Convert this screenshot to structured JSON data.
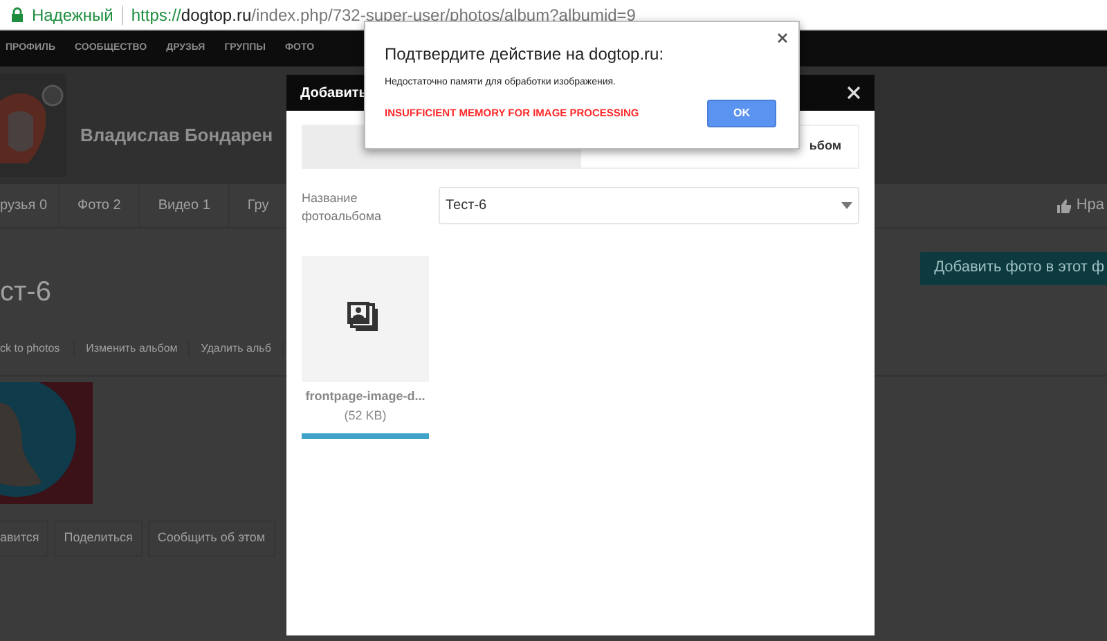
{
  "address_bar": {
    "security": "Надежный",
    "url_scheme": "https://",
    "url_host": "dogtop.ru",
    "url_path": "/index.php/732-super-user/photos/album?albumid=9"
  },
  "nav": [
    "ПРОФИЛЬ",
    "СООБЩЕСТВО",
    "ДРУЗЬЯ",
    "ГРУППЫ",
    "ФОТО"
  ],
  "profile": {
    "name": "Владислав Бондарен"
  },
  "profile_tabs": [
    "рузья 0",
    "Фото 2",
    "Видео 1",
    "Гру"
  ],
  "like_label": "Нра",
  "album": {
    "title": "ст-6",
    "add_button": "Добавить фото в этот ф",
    "links": [
      "ck to photos",
      "Изменить альбом",
      "Удалить альб"
    ],
    "actions": [
      "авится",
      "Поделиться",
      "Сообщить об этом"
    ]
  },
  "modal": {
    "title": "Добавить",
    "tabs": [
      {
        "selected": true
      },
      {
        "label": "ьбом",
        "selected": false
      }
    ],
    "album_label": "Название фотоальбома",
    "album_value": "Тест-6",
    "files": [
      {
        "name": "frontpage-image-d...",
        "size": "(52 KB)",
        "level": 1
      }
    ]
  },
  "alert": {
    "title": "Подтвердите действие на dogtop.ru:",
    "message": "Недостаточно памяти для обработки изображения.",
    "error": "INSUFFICIENT MEMORY FOR IMAGE PROCESSING",
    "button": "OK"
  }
}
